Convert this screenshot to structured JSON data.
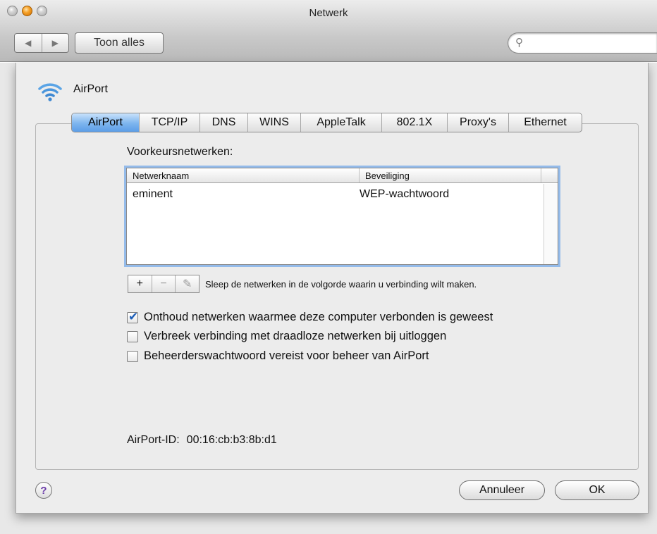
{
  "window": {
    "title": "Netwerk"
  },
  "toolbar": {
    "back_glyph": "◀",
    "forward_glyph": "▶",
    "show_all_label": "Toon alles",
    "search_value": "",
    "search_icon": "search-icon"
  },
  "sheet": {
    "interface_name": "AirPort",
    "tabs": [
      {
        "label": "AirPort",
        "active": true
      },
      {
        "label": "TCP/IP"
      },
      {
        "label": "DNS"
      },
      {
        "label": "WINS"
      },
      {
        "label": "AppleTalk"
      },
      {
        "label": "802.1X"
      },
      {
        "label": "Proxy's"
      },
      {
        "label": "Ethernet"
      }
    ],
    "preferred_label": "Voorkeursnetwerken:",
    "table": {
      "columns": [
        "Netwerknaam",
        "Beveiliging"
      ],
      "rows": [
        {
          "name": "eminent",
          "security": "WEP-wachtwoord"
        }
      ]
    },
    "list_buttons": {
      "add": "+",
      "remove": "−",
      "edit": "✎"
    },
    "hint": "Sleep de netwerken in de volgorde waarin u verbinding wilt maken.",
    "checkboxes": [
      {
        "label": "Onthoud netwerken waarmee deze computer verbonden is geweest",
        "checked": true
      },
      {
        "label": "Verbreek verbinding met draadloze netwerken bij uitloggen",
        "checked": false
      },
      {
        "label": "Beheerderswachtwoord vereist voor beheer van AirPort",
        "checked": false
      }
    ],
    "airport_id_label": "AirPort-ID:",
    "airport_id_value": "00:16:cb:b3:8b:d1",
    "help_glyph": "?",
    "cancel_label": "Annuleer",
    "ok_label": "OK"
  },
  "colors": {
    "accent": "#5c9ee7",
    "focus_ring": "#94bbea"
  }
}
